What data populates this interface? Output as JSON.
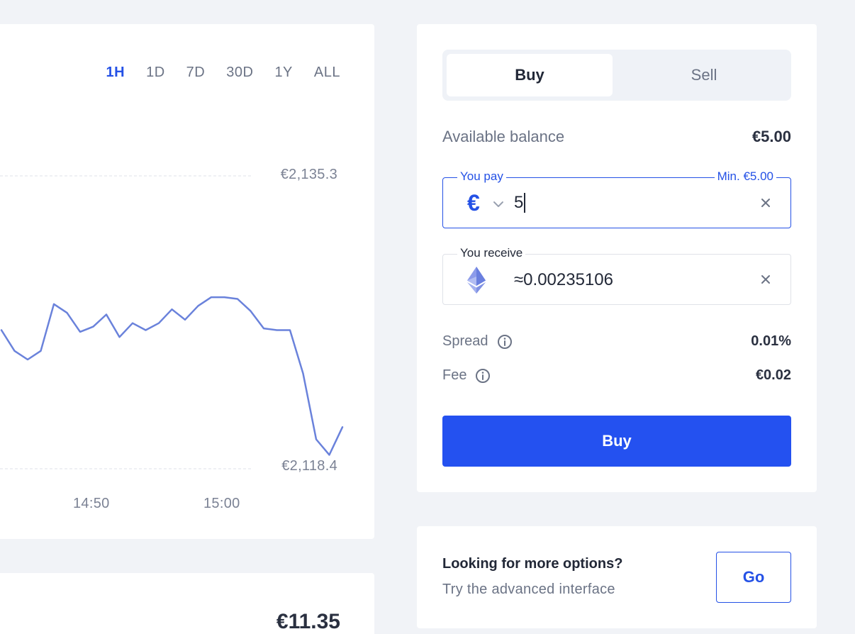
{
  "chart": {
    "ranges": [
      "1H",
      "1D",
      "7D",
      "30D",
      "1Y",
      "ALL"
    ],
    "active_range": "1H",
    "price_high_label": "€2,135.3",
    "price_low_label": "€2,118.4",
    "time_labels": [
      "14:50",
      "15:00"
    ],
    "line_color": "#6a82db",
    "grid_color": "#dfe2e8"
  },
  "chart_data": {
    "type": "line",
    "title": "",
    "xlabel": "",
    "ylabel": "",
    "x_tick_labels": [
      "14:50",
      "15:00"
    ],
    "y_tick_labels": [
      "€2,118.4",
      "€2,135.3"
    ],
    "ylim": [
      2118.4,
      2135.3
    ],
    "series": [
      {
        "values": [
          2126.4,
          2125.2,
          2124.7,
          2125.2,
          2127.9,
          2127.4,
          2126.3,
          2126.6,
          2127.3,
          2126.0,
          2126.8,
          2126.4,
          2126.8,
          2127.6,
          2127.0,
          2127.8,
          2128.3,
          2128.3,
          2128.2,
          2127.5,
          2126.5,
          2126.4,
          2126.4,
          2123.9,
          2120.1,
          2119.2,
          2120.8
        ]
      }
    ]
  },
  "summary": {
    "value": "€11.35"
  },
  "trade": {
    "tabs": {
      "buy": "Buy",
      "sell": "Sell"
    },
    "available_balance_label": "Available balance",
    "available_balance_value": "€5.00",
    "pay": {
      "legend": "You pay",
      "min_label": "Min. €5.00",
      "currency_symbol": "€",
      "value": "5"
    },
    "receive": {
      "legend": "You receive",
      "value": "≈0.00235106",
      "asset_icon": "ethereum-icon"
    },
    "spread_label": "Spread",
    "spread_value": "0.01%",
    "fee_label": "Fee",
    "fee_value": "€0.02",
    "submit_label": "Buy",
    "accent_color": "#2451e6"
  },
  "options": {
    "title": "Looking for more options?",
    "subtitle": "Try the advanced interface",
    "go_label": "Go"
  }
}
